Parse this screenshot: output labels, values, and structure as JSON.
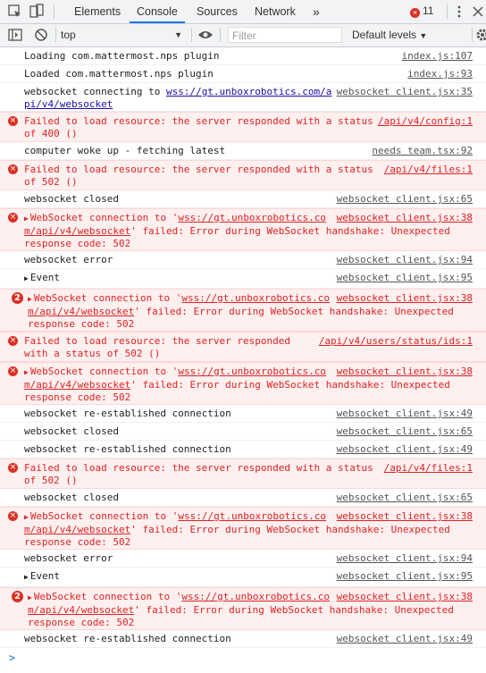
{
  "tabs": {
    "elements": "Elements",
    "console": "Console",
    "sources": "Sources",
    "network": "Network",
    "more": "»",
    "error_count": "11"
  },
  "toolbar": {
    "context": "top",
    "filter_placeholder": "Filter",
    "levels": "Default levels"
  },
  "messages": [
    {
      "text": "Loading com.mattermost.nps plugin",
      "source": "index.js:107"
    },
    {
      "text": "Loaded com.mattermost.nps plugin",
      "source": "index.js:93"
    },
    {
      "text_prefix": "websocket connecting to ",
      "text_link": "wss://gt.unboxrobotics.com/a",
      "line2": "pi/v4/websocket",
      "source": "websocket client.jsx:35"
    },
    {
      "text": "Failed to load resource: the server responded with a status",
      "line2": "of 400 ()",
      "source": "/api/v4/config:1"
    },
    {
      "text": "computer woke up - fetching latest",
      "source": "needs team.tsx:92"
    },
    {
      "text": "Failed to load resource: the server responded with a status",
      "line2": "of 502 ()",
      "source": "/api/v4/files:1"
    },
    {
      "text": "websocket closed",
      "source": "websocket client.jsx:65"
    },
    {
      "text_prefix": "WebSocket connection to '",
      "text_link": "wss://gt.unboxrobotics.co",
      "line2_link": "m/api/v4/websocket",
      "line2_rest": "' failed: Error during WebSocket handshake: Unexpected",
      "line3": "response code: 502",
      "source": "websocket client.jsx:38"
    },
    {
      "text": "websocket error",
      "source": "websocket client.jsx:94"
    },
    {
      "text": "Event",
      "source": "websocket client.jsx:95"
    },
    {
      "count": "2",
      "text_prefix": "WebSocket connection to '",
      "text_link": "wss://gt.unboxrobotics.co",
      "line2_link": "m/api/v4/websocket",
      "line2_rest": "' failed: Error during WebSocket handshake: Unexpected",
      "line3": "response code: 502",
      "source": "websocket client.jsx:38"
    },
    {
      "text": "Failed to load resource: the server responded",
      "line2": "with a status of 502 ()",
      "source": "/api/v4/users/status/ids:1"
    },
    {
      "text_prefix": "WebSocket connection to '",
      "text_link": "wss://gt.unboxrobotics.co",
      "line2_link": "m/api/v4/websocket",
      "line2_rest": "' failed: Error during WebSocket handshake: Unexpected",
      "line3": "response code: 502",
      "source": "websocket client.jsx:38"
    },
    {
      "text": "websocket re-established connection",
      "source": "websocket client.jsx:49"
    },
    {
      "text": "websocket closed",
      "source": "websocket client.jsx:65"
    },
    {
      "text": "websocket re-established connection",
      "source": "websocket client.jsx:49"
    },
    {
      "text": "Failed to load resource: the server responded with a status",
      "line2": "of 502 ()",
      "source": "/api/v4/files:1"
    },
    {
      "text": "websocket closed",
      "source": "websocket client.jsx:65"
    },
    {
      "text_prefix": "WebSocket connection to '",
      "text_link": "wss://gt.unboxrobotics.co",
      "line2_link": "m/api/v4/websocket",
      "line2_rest": "' failed: Error during WebSocket handshake: Unexpected",
      "line3": "response code: 502",
      "source": "websocket client.jsx:38"
    },
    {
      "text": "websocket error",
      "source": "websocket client.jsx:94"
    },
    {
      "text": "Event",
      "source": "websocket client.jsx:95"
    },
    {
      "count": "2",
      "text_prefix": "WebSocket connection to '",
      "text_link": "wss://gt.unboxrobotics.co",
      "line2_link": "m/api/v4/websocket",
      "line2_rest": "' failed: Error during WebSocket handshake: Unexpected",
      "line3": "response code: 502",
      "source": "websocket client.jsx:38"
    },
    {
      "text": "websocket re-established connection",
      "source": "websocket client.jsx:49"
    }
  ],
  "prompt": ">",
  "colors": {
    "error": "#d22222",
    "error_bg": "#fff0f0",
    "accent": "#1a73e8"
  }
}
